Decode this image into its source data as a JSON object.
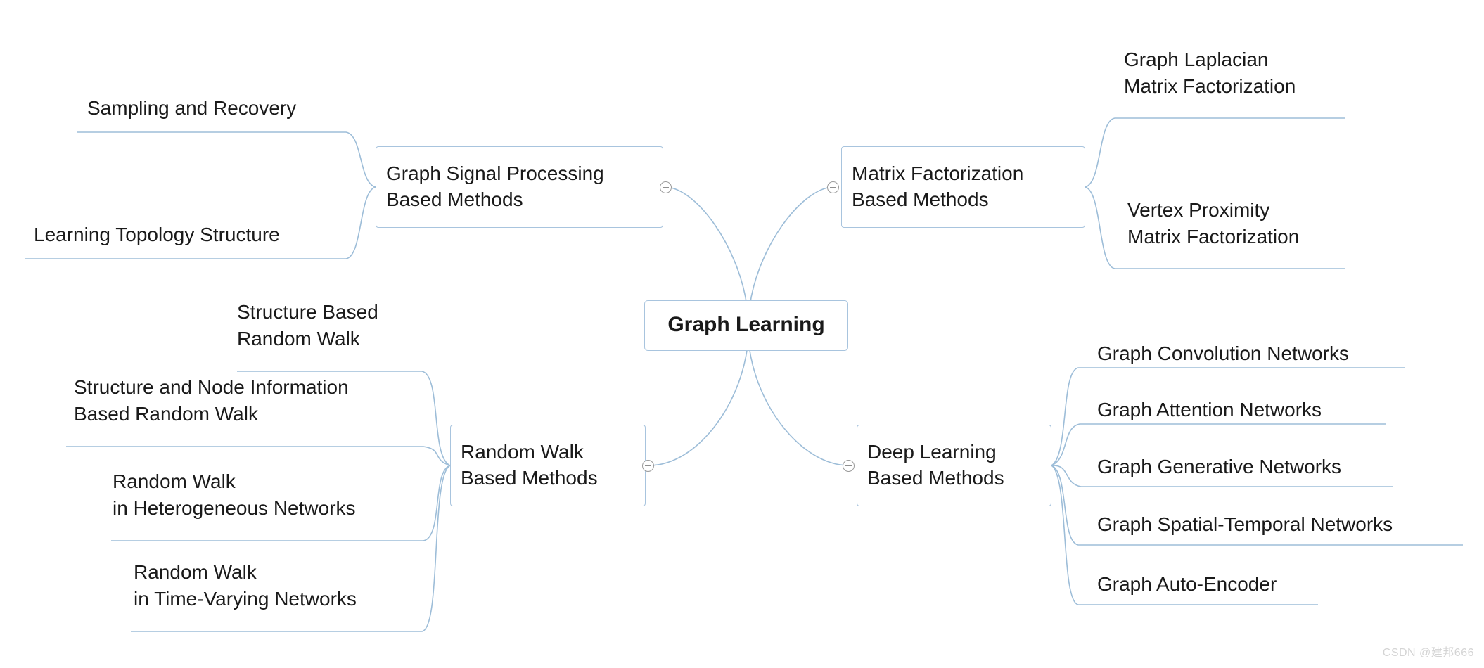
{
  "diagram": {
    "title": "Graph Learning",
    "root": {
      "label_lines": [
        "Graph Learning"
      ]
    },
    "colors": {
      "connector": "#9dbdd8",
      "node_border": "#a8c4de",
      "text": "#1a1a1a",
      "toggle_border": "#9b9b9b",
      "background": "#ffffff",
      "watermark": "#d4d4d4"
    },
    "branches": [
      {
        "id": "graph-signal-processing",
        "side": "left",
        "label_lines": [
          "Graph Signal Processing",
          "Based Methods"
        ],
        "collapsed": false,
        "toggle_state": "minus",
        "children": [
          {
            "label_lines": [
              "Sampling and Recovery"
            ]
          },
          {
            "label_lines": [
              "Learning Topology Structure"
            ]
          }
        ]
      },
      {
        "id": "random-walk",
        "side": "left",
        "label_lines": [
          "Random Walk",
          "Based Methods"
        ],
        "collapsed": false,
        "toggle_state": "minus",
        "children": [
          {
            "label_lines": [
              "Structure Based",
              "Random Walk"
            ]
          },
          {
            "label_lines": [
              "Structure and Node Information",
              "Based Random Walk"
            ]
          },
          {
            "label_lines": [
              "Random Walk",
              "in Heterogeneous Networks"
            ]
          },
          {
            "label_lines": [
              "Random Walk",
              "in Time-Varying Networks"
            ]
          }
        ]
      },
      {
        "id": "matrix-factorization",
        "side": "right",
        "label_lines": [
          "Matrix Factorization",
          "Based Methods"
        ],
        "collapsed": false,
        "toggle_state": "minus",
        "children": [
          {
            "label_lines": [
              "Graph Laplacian",
              "Matrix Factorization"
            ]
          },
          {
            "label_lines": [
              "Vertex Proximity",
              "Matrix Factorization"
            ]
          }
        ]
      },
      {
        "id": "deep-learning",
        "side": "right",
        "label_lines": [
          "Deep Learning",
          "Based Methods"
        ],
        "collapsed": false,
        "toggle_state": "minus",
        "children": [
          {
            "label_lines": [
              "Graph Convolution Networks"
            ]
          },
          {
            "label_lines": [
              "Graph Attention Networks"
            ]
          },
          {
            "label_lines": [
              "Graph Generative Networks"
            ]
          },
          {
            "label_lines": [
              "Graph Spatial-Temporal Networks"
            ]
          },
          {
            "label_lines": [
              "Graph Auto-Encoder"
            ]
          }
        ]
      }
    ]
  },
  "watermark": {
    "text": "CSDN @建邦666"
  }
}
